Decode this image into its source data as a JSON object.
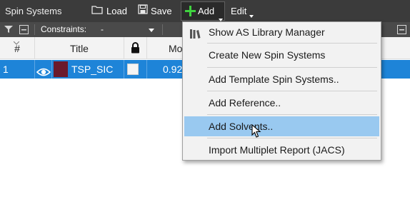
{
  "toolbar": {
    "title": "Spin Systems",
    "load_label": "Load",
    "save_label": "Save",
    "add_label": "Add",
    "edit_label": "Edit"
  },
  "subbar": {
    "constraints_label": "Constraints:",
    "constraints_value": "-"
  },
  "table": {
    "columns": [
      "#",
      "Title",
      "",
      "Mo"
    ],
    "rows": [
      {
        "index": "1",
        "title": "TSP_SIC",
        "value": "0.92"
      }
    ]
  },
  "menu": {
    "items": [
      "Show AS Library Manager",
      "Create New Spin Systems",
      "Add Template Spin Systems..",
      "Add Reference..",
      "Add Solvents..",
      "Import Multiplet Report (JACS)"
    ],
    "highlighted_index": 4
  },
  "colors": {
    "toolbar_bg": "#3b3b3b",
    "selection_bg": "#1e84d8",
    "menu_highlight": "#99c9f0",
    "add_icon_green": "#3fd23f",
    "row_color_swatch": "#6b1a2c"
  },
  "icons": [
    "folder-icon",
    "floppy-disk-icon",
    "plus-icon",
    "filter-icon",
    "lock-icon",
    "eye-icon",
    "library-icon"
  ]
}
